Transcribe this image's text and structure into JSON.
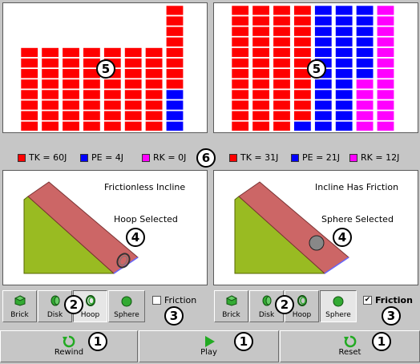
{
  "left": {
    "bars": [
      [
        "red",
        "red",
        "red",
        "red",
        "red",
        "red",
        "red",
        "red"
      ],
      [
        "red",
        "red",
        "red",
        "red",
        "red",
        "red",
        "red",
        "red"
      ],
      [
        "red",
        "red",
        "red",
        "red",
        "red",
        "red",
        "red",
        "red"
      ],
      [
        "red",
        "red",
        "red",
        "red",
        "red",
        "red",
        "red",
        "red"
      ],
      [
        "red",
        "red",
        "red",
        "red",
        "red",
        "red",
        "red",
        "red"
      ],
      [
        "red",
        "red",
        "red",
        "red",
        "red",
        "red",
        "red",
        "red"
      ],
      [
        "red",
        "red",
        "red",
        "red",
        "red",
        "red",
        "red",
        "red"
      ],
      [
        "red",
        "red",
        "red",
        "red",
        "red",
        "red",
        "red",
        "red",
        "blue",
        "blue",
        "blue",
        "blue"
      ]
    ],
    "legend": [
      {
        "label": "TK = 60J",
        "color": "#ff0000"
      },
      {
        "label": "PE = 4J",
        "color": "#0000ff"
      },
      {
        "label": "RK = 0J",
        "color": "#ff00ff"
      }
    ],
    "scene_title": "Frictionless Incline",
    "selected_text": "Hoop Selected",
    "friction_label": "Friction",
    "friction_checked": false
  },
  "right": {
    "bars": [
      [
        "red",
        "red",
        "red",
        "red",
        "red",
        "red",
        "red",
        "red",
        "red",
        "red",
        "red",
        "red"
      ],
      [
        "red",
        "red",
        "red",
        "red",
        "red",
        "red",
        "red",
        "red",
        "red",
        "red",
        "red",
        "red"
      ],
      [
        "red",
        "red",
        "red",
        "red",
        "red",
        "red",
        "red",
        "red",
        "red",
        "red",
        "red",
        "red"
      ],
      [
        "red",
        "red",
        "red",
        "red",
        "red",
        "red",
        "red",
        "red",
        "red",
        "red",
        "red",
        "blue"
      ],
      [
        "blue",
        "blue",
        "blue",
        "blue",
        "blue",
        "blue",
        "blue",
        "blue",
        "blue",
        "blue",
        "blue",
        "blue"
      ],
      [
        "blue",
        "blue",
        "blue",
        "blue",
        "blue",
        "blue",
        "blue",
        "blue",
        "blue",
        "blue",
        "blue",
        "blue"
      ],
      [
        "blue",
        "blue",
        "blue",
        "blue",
        "blue",
        "blue",
        "blue",
        "magenta",
        "magenta",
        "magenta",
        "magenta",
        "magenta"
      ],
      [
        "magenta",
        "magenta",
        "magenta",
        "magenta",
        "magenta",
        "magenta",
        "magenta",
        "magenta",
        "magenta",
        "magenta",
        "magenta",
        "magenta"
      ]
    ],
    "legend": [
      {
        "label": "TK = 31J",
        "color": "#ff0000"
      },
      {
        "label": "PE = 21J",
        "color": "#0000ff"
      },
      {
        "label": "RK = 12J",
        "color": "#ff00ff"
      }
    ],
    "scene_title": "Incline Has Friction",
    "selected_text": "Sphere Selected",
    "friction_label": "Friction",
    "friction_checked": true
  },
  "object_buttons": [
    "Brick",
    "Disk",
    "Hoop",
    "Sphere"
  ],
  "left_selected_object": "Hoop",
  "right_selected_object": "Sphere",
  "controls": {
    "rewind_label": "Rewind",
    "play_label": "Play",
    "reset_label": "Reset"
  },
  "callouts": {
    "energy_bars": "5",
    "legend": "6",
    "selected_object": "4",
    "object_buttons": "2",
    "friction": "3",
    "controls": "1"
  },
  "colors": {
    "red": "#ff0000",
    "blue": "#0000ff",
    "magenta": "#ff00ff",
    "incline_top": "#cc6666",
    "incline_side": "#99bb22",
    "incline_front": "#b35555"
  }
}
